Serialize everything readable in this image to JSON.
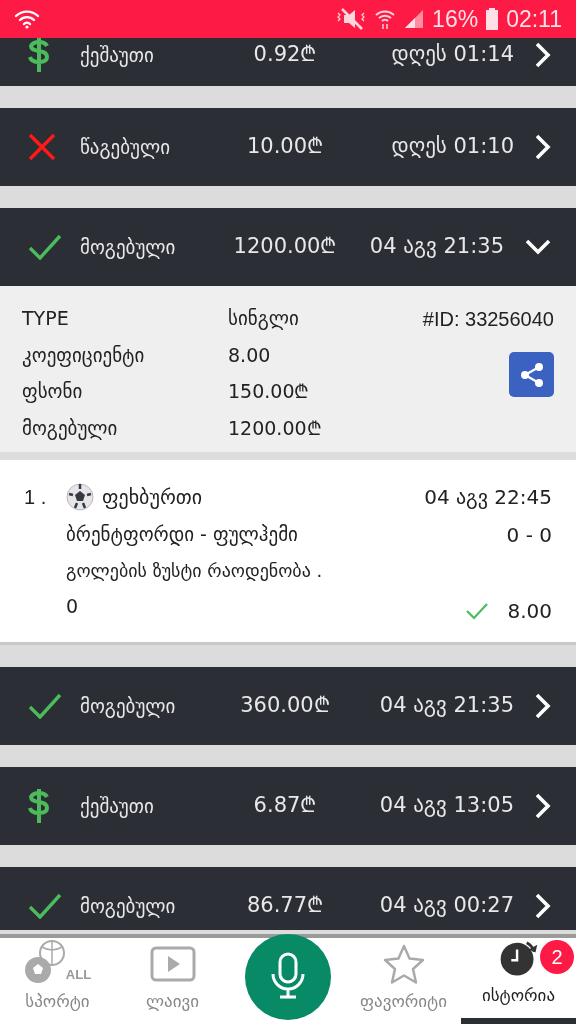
{
  "status_bar": {
    "battery_text": "16%",
    "time": "02:11"
  },
  "bets": [
    {
      "kind": "cashout",
      "status": "ქეშაუთი",
      "amount": "0.92₾",
      "time": "დღეს 01:14",
      "expanded": false,
      "clipped": true
    },
    {
      "kind": "lost",
      "status": "წაგებული",
      "amount": "10.00₾",
      "time": "დღეს 01:10",
      "expanded": false
    },
    {
      "kind": "won",
      "status": "მოგებული",
      "amount": "1200.00₾",
      "time": "04 აგვ 21:35",
      "expanded": true,
      "details": {
        "rows": [
          {
            "label": "TYPE",
            "value": "სინგლი"
          },
          {
            "label": "კოეფიციენტი",
            "value": "8.00"
          },
          {
            "label": "ფსონი",
            "value": "150.00₾"
          },
          {
            "label": "მოგებული",
            "value": "1200.00₾"
          }
        ],
        "id": "#ID: 33256040"
      },
      "selections": [
        {
          "number": "1 .",
          "sport": "ფეხბურთი",
          "date": "04 აგვ 22:45",
          "match": "ბრენტფორდი - ფულჰემი",
          "score": "0 - 0",
          "market": "გოლების ზუსტი რაოდენობა .",
          "pick": "0",
          "won": true,
          "odds": "8.00"
        }
      ]
    },
    {
      "kind": "won",
      "status": "მოგებული",
      "amount": "360.00₾",
      "time": "04 აგვ 21:35",
      "expanded": false
    },
    {
      "kind": "cashout",
      "status": "ქეშაუთი",
      "amount": "6.87₾",
      "time": "04 აგვ 13:05",
      "expanded": false
    },
    {
      "kind": "won",
      "status": "მოგებული",
      "amount": "86.77₾",
      "time": "04 აგვ 00:27",
      "expanded": false
    }
  ],
  "nav": [
    {
      "kind": "sports",
      "label": "სპორტი",
      "icon_text": "ALL",
      "selected": false
    },
    {
      "kind": "live",
      "label": "ლაივი",
      "selected": false
    },
    {
      "kind": "mic",
      "selected": false
    },
    {
      "kind": "favorites",
      "label": "ფავორიტი",
      "selected": false
    },
    {
      "kind": "history",
      "label": "ისტორია",
      "badge": "2",
      "selected": true
    }
  ]
}
